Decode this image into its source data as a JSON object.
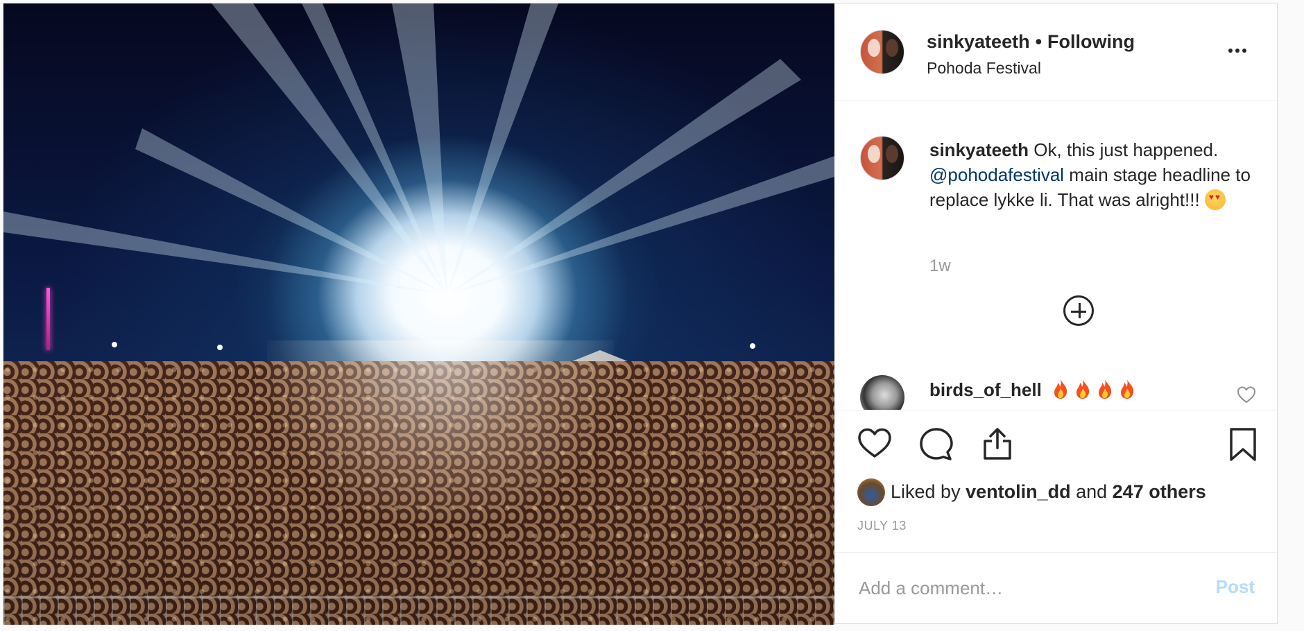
{
  "header": {
    "username": "sinkyateeth",
    "separator": "•",
    "follow_status": "Following",
    "location": "Pohoda Festival"
  },
  "caption": {
    "username": "sinkyateeth",
    "text_before": " Ok, this just happened. ",
    "mention": "@pohodafestival",
    "text_after": " main stage headline to replace lykke li. That was alright!!! ",
    "emoji": "heart-eyes",
    "time": "1w"
  },
  "comments": [
    {
      "username": "birds_of_hell",
      "emoji": [
        "fire",
        "fire",
        "fire",
        "fire"
      ]
    }
  ],
  "likes": {
    "prefix": "Liked by ",
    "user": "ventolin_dd",
    "middle": " and ",
    "others": "247 others"
  },
  "date": "JULY 13",
  "add_comment": {
    "placeholder": "Add a comment…",
    "post_label": "Post"
  },
  "colors": {
    "text": "#262626",
    "muted": "#999999",
    "mention": "#003569",
    "post_disabled": "#b3dbff"
  }
}
